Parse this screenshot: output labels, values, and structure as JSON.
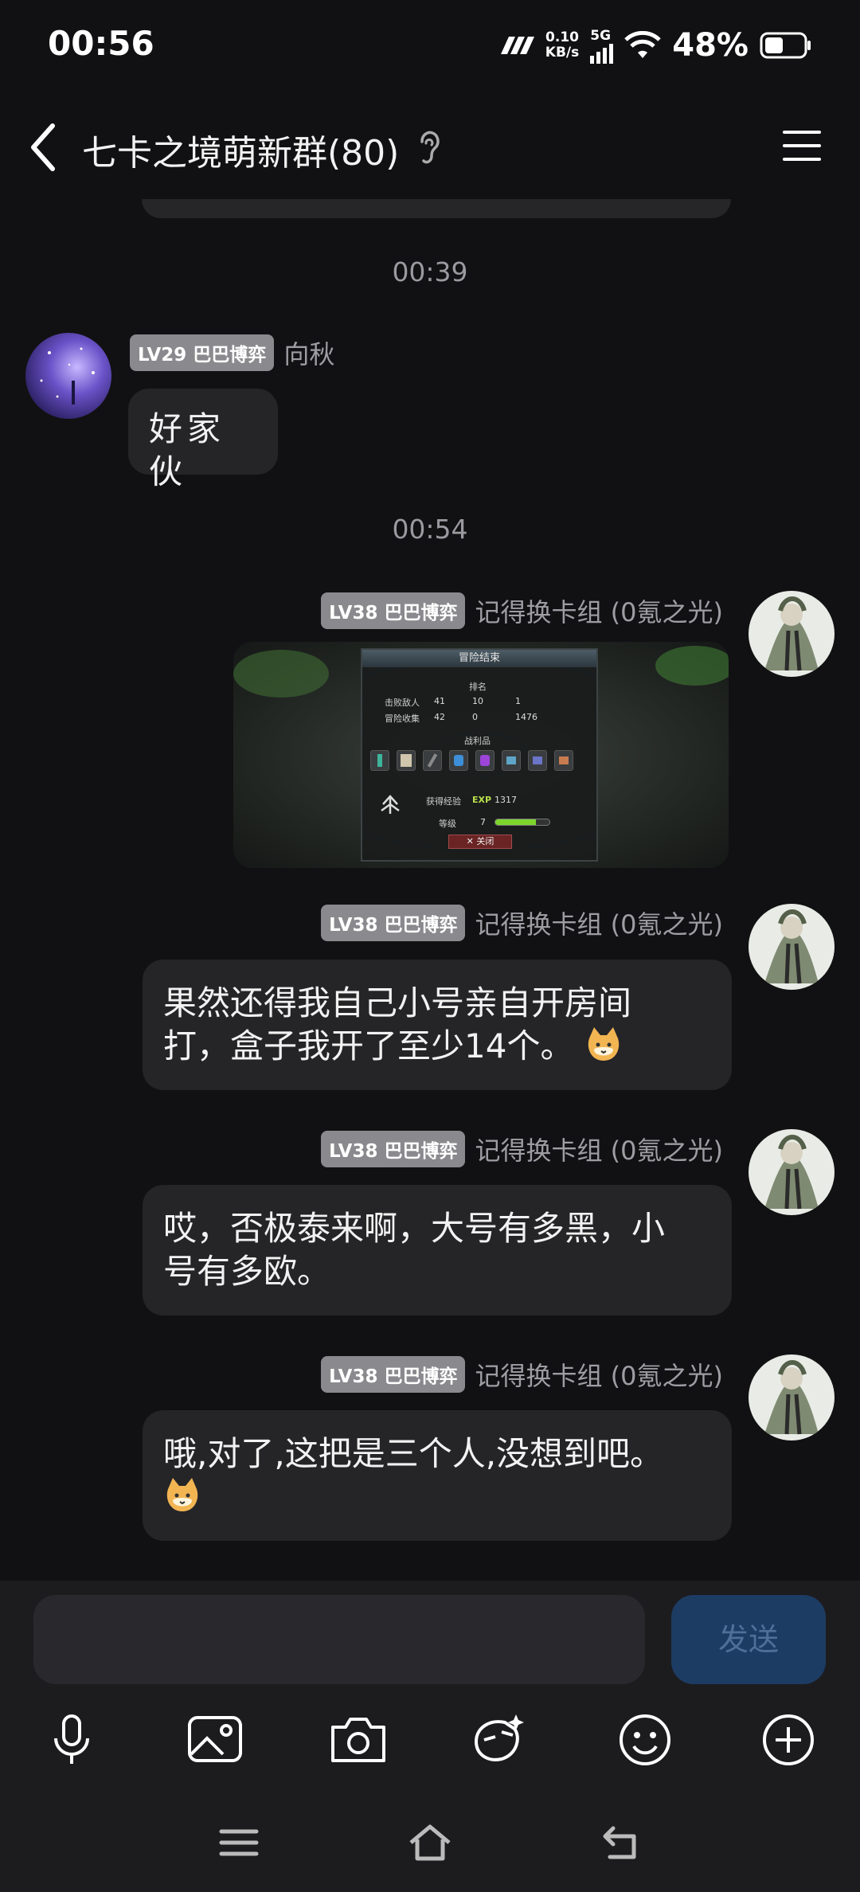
{
  "status_bar": {
    "time": "00:56",
    "net_speed_value": "0.10",
    "net_speed_unit": "KB/s",
    "network": "5G",
    "battery": "48%"
  },
  "header": {
    "title": "七卡之境萌新群(80)"
  },
  "chat": {
    "dividers": [
      "00:39",
      "00:54"
    ],
    "messages": [
      {
        "level": "LV29 巴巴博弈",
        "sender": "向秋",
        "text": "好家伙"
      },
      {
        "level": "LV38 巴巴博弈",
        "sender": "记得换卡组 (0氪之光)",
        "type": "image",
        "game_screenshot": {
          "title": "冒险结束",
          "rank_label": "排名",
          "kills_label": "击败敌人",
          "collect_label": "冒险收集",
          "kills_values": [
            "41",
            "10",
            "1"
          ],
          "collect_values": [
            "42",
            "0",
            "1476"
          ],
          "loot_label": "战利品",
          "exp_label": "获得经验",
          "exp_tag": "EXP",
          "exp_value": "1317",
          "level_label": "等级",
          "level_value": "7",
          "exp_progress": 0.75,
          "close_label": "关闭"
        }
      },
      {
        "level": "LV38 巴巴博弈",
        "sender": "记得换卡组 (0氪之光)",
        "line1": "果然还得我自己小号亲自开房间",
        "line2": "打，盒子我开了至少14个。"
      },
      {
        "level": "LV38 巴巴博弈",
        "sender": "记得换卡组 (0氪之光)",
        "line1": "哎，否极泰来啊，大号有多黑，小",
        "line2": "号有多欧。"
      },
      {
        "level": "LV38 巴巴博弈",
        "sender": "记得换卡组 (0氪之光)",
        "line1": "哦,对了,这把是三个人,没想到吧。"
      }
    ]
  },
  "input": {
    "value": "",
    "send_label": "发送"
  },
  "icons": {
    "toolbar": [
      "microphone-icon",
      "image-icon",
      "camera-icon",
      "sticker-icon",
      "emoji-icon",
      "plus-icon"
    ],
    "nav": [
      "recents-icon",
      "home-icon",
      "back-icon"
    ]
  },
  "colors": {
    "background": "#111113",
    "bubble": "#252528",
    "badge": "#8a8a8e",
    "send_button": "#1d3c63"
  }
}
